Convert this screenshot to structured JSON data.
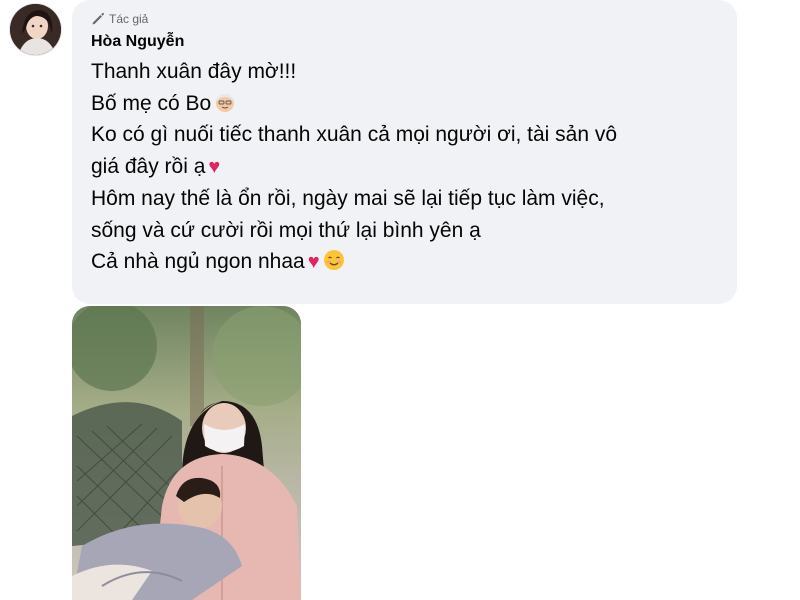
{
  "post": {
    "author_badge": "Tác giả",
    "author_name": "Hòa Nguyễn",
    "lines": [
      "Thanh xuân đây mờ!!!",
      "Bố mẹ có Bo",
      "Ko có gì nuối tiếc thanh xuân cả mọi người ơi, tài sản vô",
      "giá đây rồi ạ",
      "Hôm nay thế là ổn rồi, ngày mai sẽ lại tiếp tục làm việc,",
      "sống và cứ cười rồi mọi thứ lại bình yên ạ",
      "Cả nhà ngủ ngon nhaa"
    ],
    "emojis": {
      "grandpa": "older-man-emoji",
      "heart": "♥",
      "smile": "smiling-face-emoji"
    },
    "colors": {
      "bubble": "#f0f2f5",
      "badge_text": "#65676b",
      "heart": "#e0245e"
    }
  }
}
